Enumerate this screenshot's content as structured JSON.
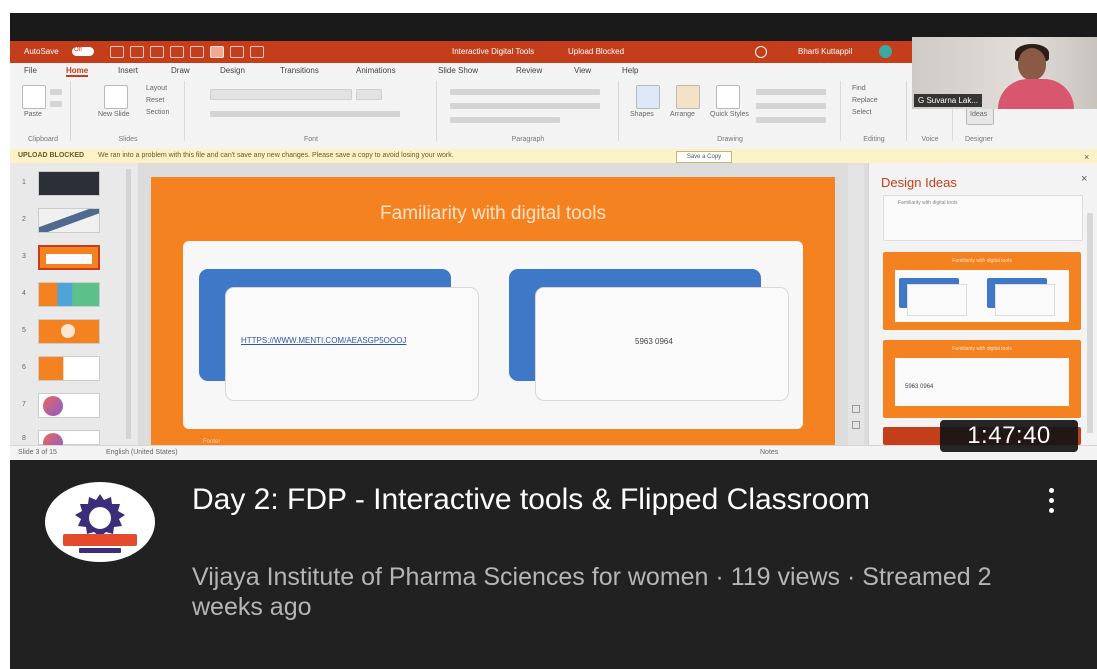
{
  "powerpoint": {
    "title_bar": {
      "autosave_label": "AutoSave",
      "autosave_state": "Off",
      "document_title": "Interactive Digital Tools",
      "upload_status": "Upload Blocked",
      "user_name": "Bharti Kuttappil"
    },
    "menu_tabs": [
      "File",
      "Home",
      "Insert",
      "Draw",
      "Design",
      "Transitions",
      "Animations",
      "Slide Show",
      "Review",
      "View",
      "Help"
    ],
    "active_tab": "Home",
    "ribbon": {
      "paste_label": "Paste",
      "clipboard_label": "Clipboard",
      "new_slide_label": "New Slide",
      "layout_label": "Layout",
      "reset_label": "Reset",
      "section_label": "Section",
      "slides_label": "Slides",
      "font_label": "Font",
      "paragraph_label": "Paragraph",
      "shapes_label": "Shapes",
      "arrange_label": "Arrange",
      "quick_styles_label": "Quick Styles",
      "drawing_label": "Drawing",
      "find_label": "Find",
      "replace_label": "Replace",
      "select_label": "Select",
      "editing_label": "Editing",
      "voice_label": "Voice",
      "designer_label": "Designer",
      "ideas_label": "Ideas"
    },
    "message_bar": {
      "tag": "UPLOAD BLOCKED",
      "text": "We ran into a problem with this file and can't save any new changes. Please save a copy to avoid losing your work.",
      "button": "Save a Copy"
    },
    "thumbnail_numbers": [
      "1",
      "2",
      "3",
      "4",
      "5",
      "6",
      "7",
      "8"
    ],
    "selected_slide": "3",
    "slide": {
      "title": "Familiarity with digital tools",
      "link_text": "HTTPS://WWW.MENTI.COM/AEASGP5OOOJ",
      "code_text": "5963 0964",
      "footer_text": "Footer"
    },
    "design_ideas": {
      "title": "Design Ideas",
      "top_card_text": "Familiarity with digital tools",
      "card2_title": "Familiarity with digital tools",
      "card3_title": "Familiarity with digital tools",
      "card3_code": "5963 0964"
    },
    "status_bar": {
      "slide_count": "Slide 3 of 15",
      "language": "English (United States)",
      "notes": "Notes"
    }
  },
  "webcam": {
    "participant_label": "G Suvarna Lak..."
  },
  "video": {
    "duration": "1:47:40",
    "title": "Day 2: FDP - Interactive tools & Flipped Classroom",
    "channel": "Vijaya Institute of Pharma Sciences for women",
    "views": "119 views",
    "streamed": "Streamed 2 weeks ago",
    "separator": "·"
  },
  "colors": {
    "ppt_accent": "#c43e1c",
    "slide_orange": "#f58220",
    "card_blue": "#3e78c6",
    "info_bg": "#212121",
    "logo_purple": "#3b2d7a"
  },
  "icons": {
    "menu": "more-vert-icon",
    "search": "search-icon",
    "close": "close-icon"
  }
}
